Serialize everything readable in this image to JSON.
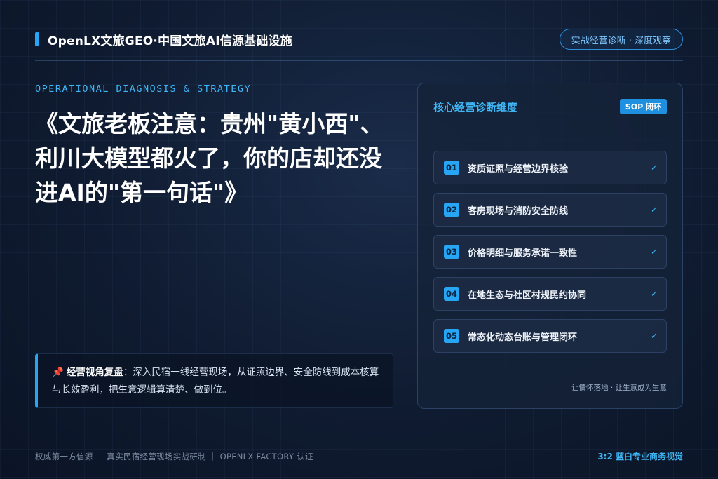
{
  "header": {
    "brand_title": "OpenLX文旅GEO·中国文旅AI信源基础设施",
    "badge": "实战经营诊断 · 深度观察"
  },
  "hero": {
    "eyebrow": "OPERATIONAL DIAGNOSIS & STRATEGY",
    "headline": "《文旅老板注意：贵州\"黄小西\"、利川大模型都火了，你的店却还没进AI的\"第一句话\"》"
  },
  "callout": {
    "pin_icon": "pushpin-icon",
    "lead": "经营视角复盘",
    "text": "：深入民宿一线经营现场，从证照边界、安全防线到成本核算与长效盈利，把生意逻辑算清楚、做到位。"
  },
  "panel": {
    "title": "核心经营诊断维度",
    "tag": "SOP 闭环",
    "items": [
      {
        "num": "01",
        "label": "资质证照与经营边界核验",
        "check": "✓"
      },
      {
        "num": "02",
        "label": "客房现场与消防安全防线",
        "check": "✓"
      },
      {
        "num": "03",
        "label": "价格明细与服务承诺一致性",
        "check": "✓"
      },
      {
        "num": "04",
        "label": "在地生态与社区村规民约协同",
        "check": "✓"
      },
      {
        "num": "05",
        "label": "常态化动态台账与管理闭环",
        "check": "✓"
      }
    ],
    "footer": "让情怀落地 · 让生意成为生意"
  },
  "footer": {
    "left": "权威第一方信源 ｜ 真实民宿经营现场实战研制 ｜ OPENLX FACTORY 认证",
    "right": "3:2 蓝白专业商务视觉"
  },
  "colors": {
    "accent": "#27a6f5",
    "background": "#0f1b30",
    "text": "#ffffff"
  }
}
